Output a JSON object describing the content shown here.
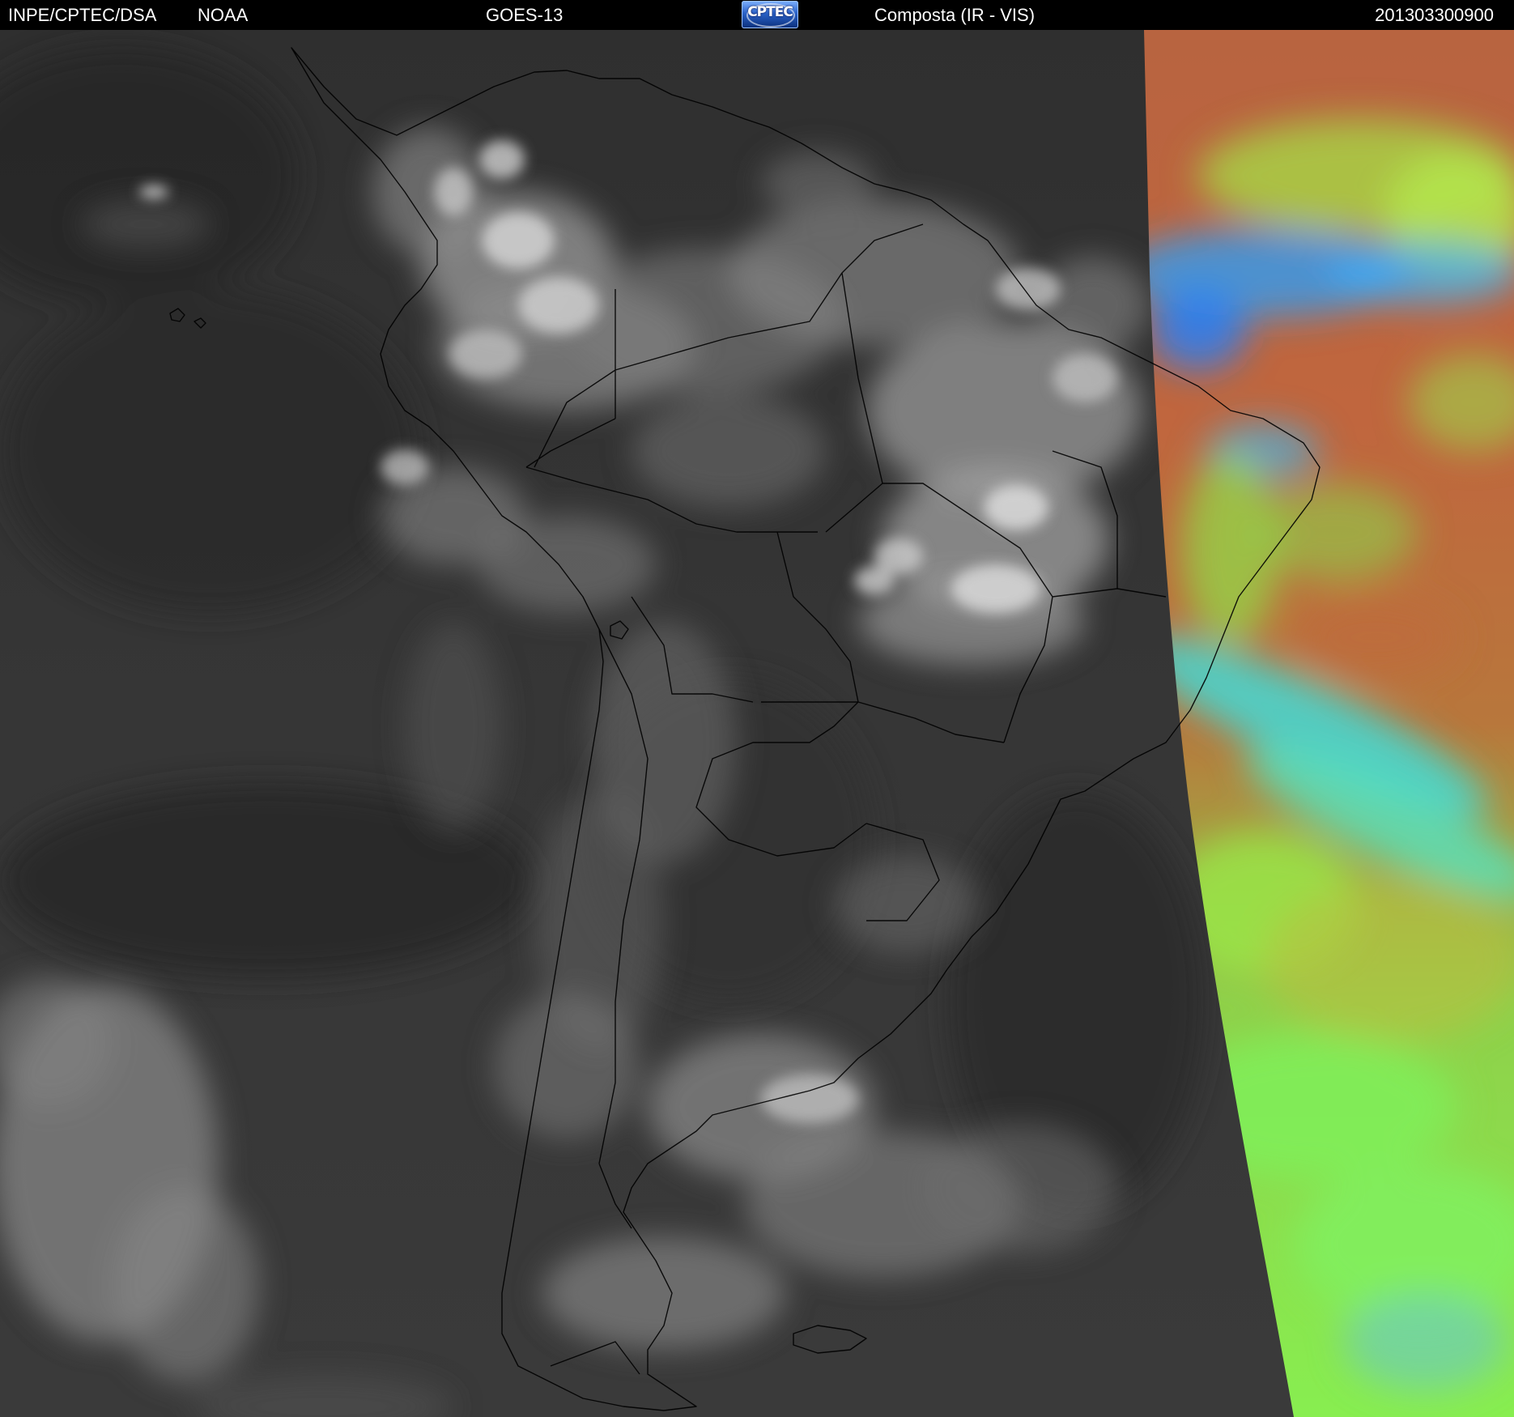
{
  "header": {
    "agency": "INPE/CPTEC/DSA",
    "provider": "NOAA",
    "satellite": "GOES-13",
    "logo_text": "CPTEC",
    "product": "Composta (IR - VIS)",
    "timestamp": "201303300900"
  },
  "colors": {
    "background": "#000000",
    "header_text": "#ffffff",
    "ir_dark_gray": "#333333",
    "vis_orange": "#c86a3c",
    "vis_green": "#8cf04a",
    "vis_cyan": "#3ce0e0",
    "border_lines": "#000000"
  },
  "map": {
    "region": "South America",
    "icon": "satellite-imagery"
  }
}
